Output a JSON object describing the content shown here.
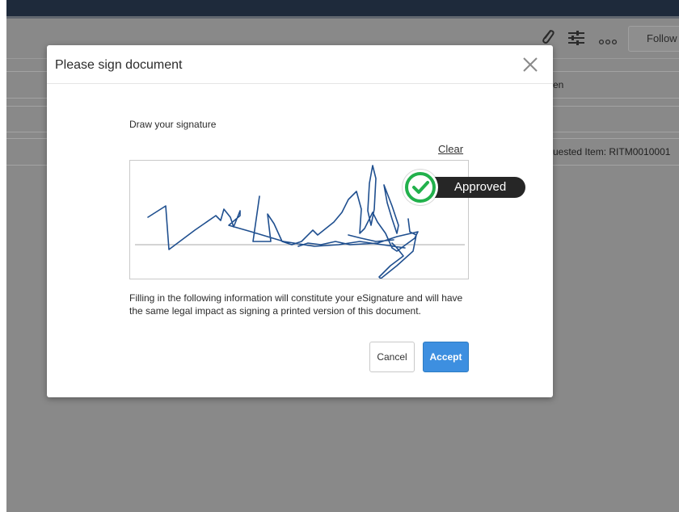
{
  "background": {
    "toolbar": {
      "follow_label": "Follow",
      "icons": [
        "paperclip-icon",
        "sliders-icon",
        "more-icon"
      ]
    },
    "fragments": {
      "row_text": "en",
      "requested_item": "uested Item: RITM0010001"
    }
  },
  "modal": {
    "title": "Please sign document",
    "close_icon": "close-icon",
    "draw_label": "Draw your signature",
    "clear_label": "Clear",
    "disclaimer": "Filling in the following information will constitute your eSignature and will have the same legal impact as signing a printed version of this document.",
    "cancel_label": "Cancel",
    "accept_label": "Accept",
    "accent_color": "#3d8fe0"
  },
  "badge": {
    "label": "Approved",
    "icon": "check-icon",
    "color": "#22b14c"
  }
}
